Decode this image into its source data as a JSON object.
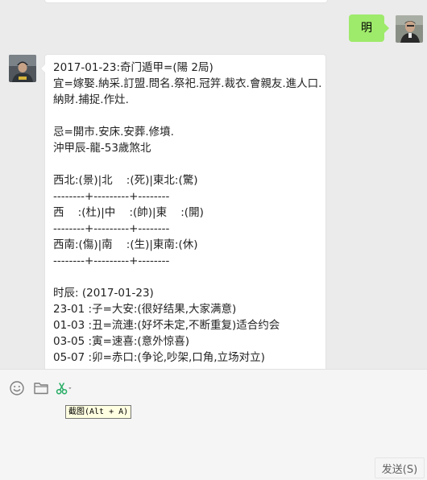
{
  "conversation": {
    "sent_message": "明",
    "received_message_lines": [
      "2017-01-23:奇门遁甲=(陽 2局)",
      "宜=嫁娶.納采.訂盟.問名.祭祀.冠笄.裁衣.會親友.進人口.",
      "納財.捕捉.作灶.",
      "",
      "忌=開市.安床.安葬.修墳.",
      "沖甲辰-龍-53歲煞北",
      "",
      "西北:(景)|北    :(死)|東北:(驚)",
      "--------+---------+--------",
      "西    :(杜)|中    :(帥)|東    :(開)",
      "--------+---------+--------",
      "西南:(傷)|南    :(生)|東南:(休)",
      "--------+---------+--------",
      "",
      "时辰: (2017-01-23)",
      "23-01 :子=大安:(很好结果,大家满意)",
      "01-03 :丑=流連:(好坏未定,不断重复)适合约会",
      "03-05 :寅=速喜:(意外惊喜)",
      "05-07 :卯=赤口:(争论,吵架,口角,立场对立)"
    ]
  },
  "toolbar": {
    "emoji_icon": "smiley-icon",
    "folder_icon": "folder-icon",
    "screenshot_icon": "scissors-icon",
    "tooltip": "截图(Alt + A)"
  },
  "send_button": "发送(S)",
  "colors": {
    "chat_background": "#ebebeb",
    "input_background": "#f5f5f5",
    "sent_bubble": "#9eea6a",
    "received_bubble": "#ffffff",
    "scissors_green": "#2aae67"
  }
}
